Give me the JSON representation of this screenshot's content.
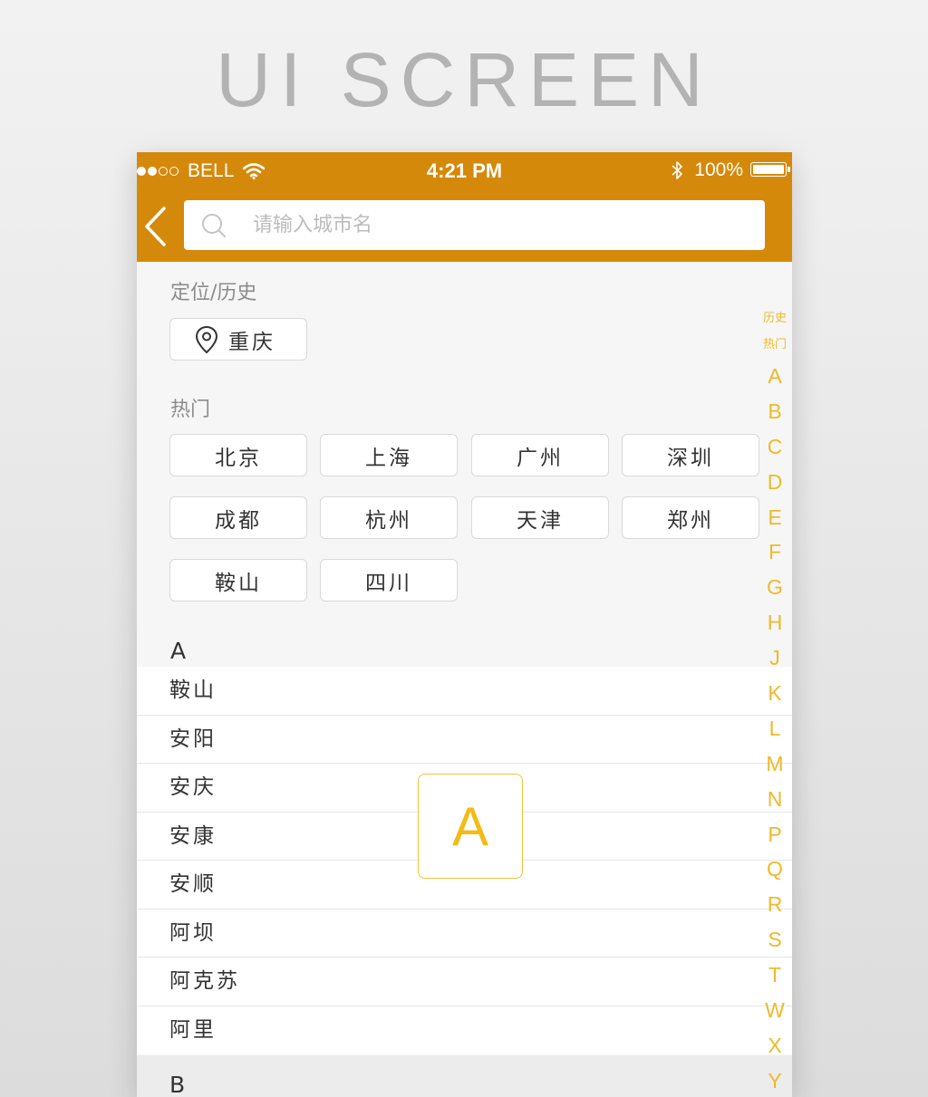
{
  "banner_text": "UI SCREEN",
  "status_bar": {
    "carrier": "BELL",
    "time": "4:21 PM",
    "battery": "100%"
  },
  "search": {
    "placeholder": "请输入城市名"
  },
  "location_section": {
    "title": "定位/历史",
    "current_city": "重庆"
  },
  "hot_section": {
    "title": "热门",
    "cities": [
      "北京",
      "上海",
      "广州",
      "深圳",
      "成都",
      "杭州",
      "天津",
      "郑州",
      "鞍山",
      "四川"
    ]
  },
  "groups": [
    {
      "letter": "A",
      "cities": [
        "鞍山",
        "安阳",
        "安庆",
        "安康",
        "安顺",
        "阿坝",
        "阿克苏",
        "阿里"
      ]
    },
    {
      "letter": "B",
      "cities": []
    }
  ],
  "index_bar": {
    "small": [
      "历史",
      "热门"
    ],
    "letters": [
      "A",
      "B",
      "C",
      "D",
      "E",
      "F",
      "G",
      "H",
      "J",
      "K",
      "L",
      "M",
      "N",
      "P",
      "Q",
      "R",
      "S",
      "T",
      "W",
      "X",
      "Y"
    ]
  },
  "toast_letter": "A",
  "colors": {
    "primary": "#d5890a",
    "accent": "#f0b92a",
    "background": "#f6f6f6"
  }
}
